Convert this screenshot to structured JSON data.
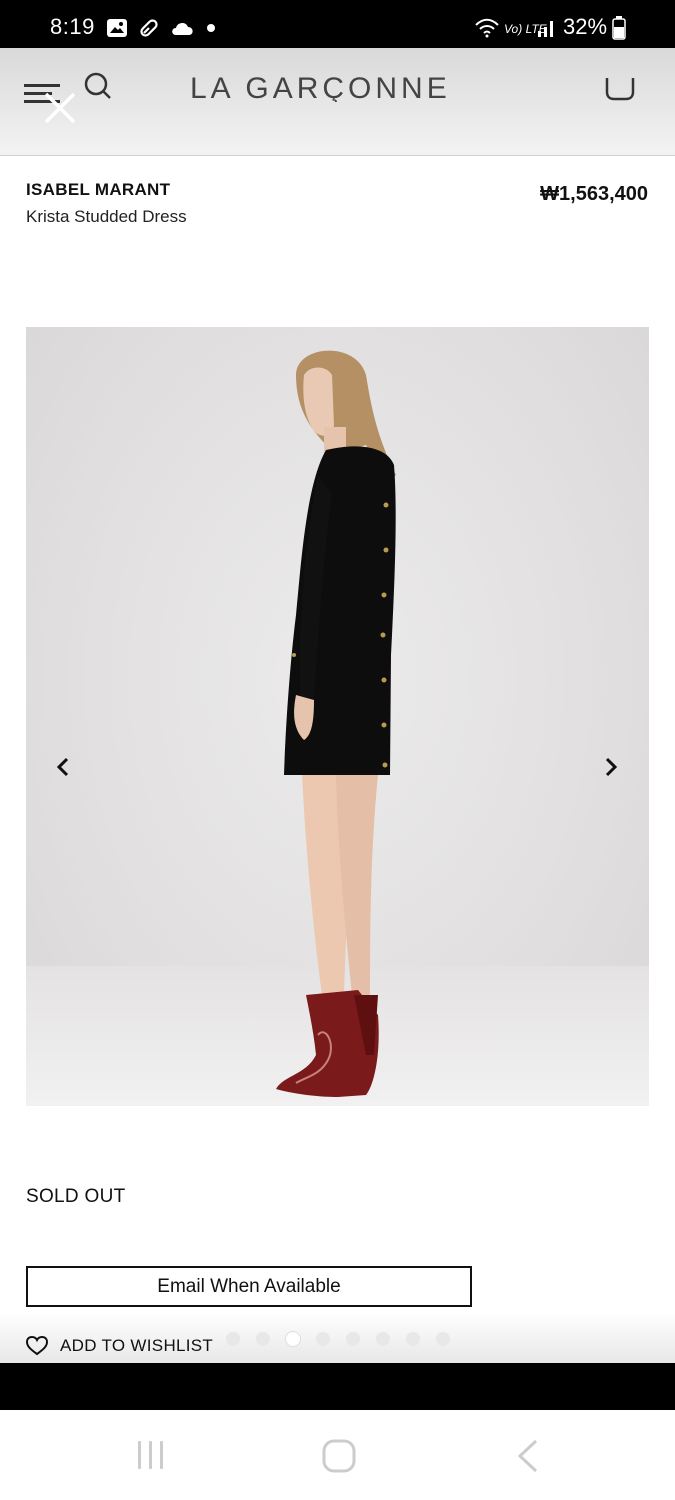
{
  "status_bar": {
    "time": "8:19",
    "network_label": "Vo) LTE",
    "battery": "32%"
  },
  "header": {
    "brand": "LA GARÇONNE"
  },
  "product": {
    "brand": "ISABEL MARANT",
    "name": "Krista Studded Dress",
    "price": "₩1,563,400",
    "availability": "SOLD OUT",
    "email_button": "Email When Available",
    "wishlist": "ADD TO WISHLIST"
  },
  "gallery": {
    "image_count": 8,
    "active_index": 3
  },
  "colors": {
    "status_bar_bg": "#000000",
    "text": "#111111",
    "boot_red": "#7a1a1a"
  },
  "icons": [
    "image-icon",
    "pill-icon",
    "cloud-icon",
    "dot-icon",
    "wifi-icon",
    "signal-icon",
    "battery-icon",
    "menu-icon",
    "close-icon",
    "search-icon",
    "bag-icon",
    "chevron-left-icon",
    "chevron-right-icon",
    "heart-icon",
    "recents-icon",
    "home-icon",
    "back-icon"
  ]
}
